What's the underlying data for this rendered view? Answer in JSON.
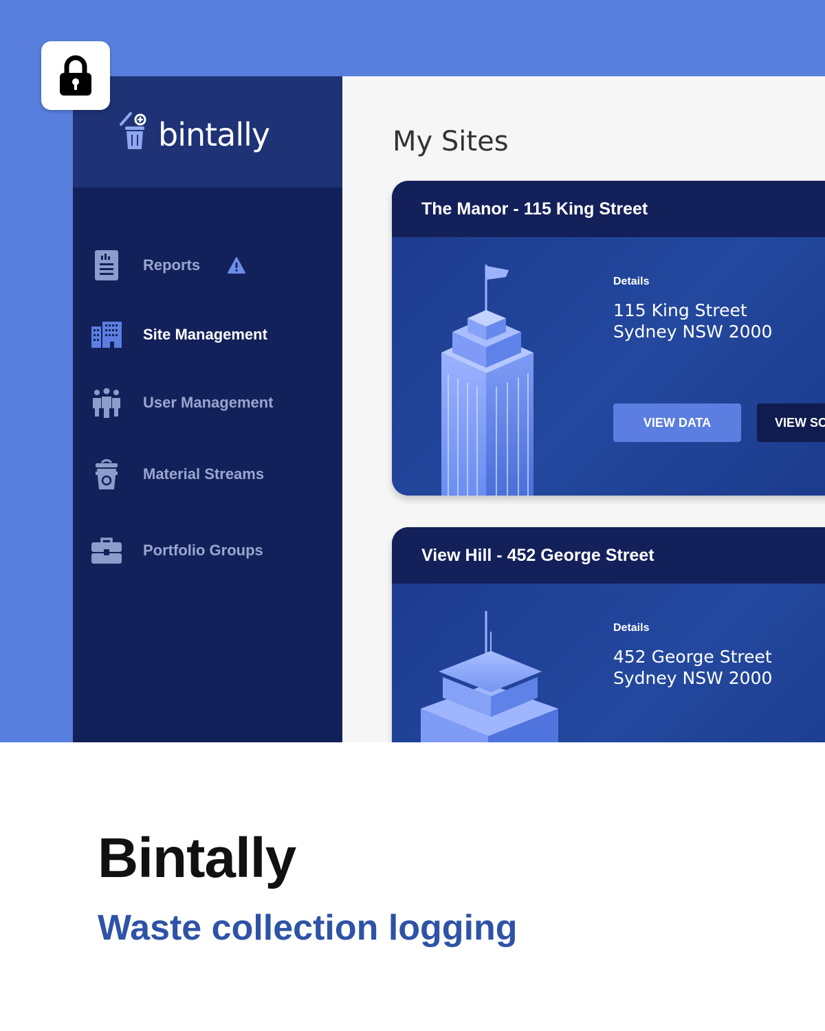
{
  "app": {
    "brand_name": "bintally"
  },
  "sidebar": {
    "items": [
      {
        "label": "Reports",
        "icon": "report-icon",
        "has_warning": true
      },
      {
        "label": "Site Management",
        "icon": "building-icon",
        "active": true
      },
      {
        "label": "User Management",
        "icon": "users-icon"
      },
      {
        "label": "Material Streams",
        "icon": "recycle-bin-icon"
      },
      {
        "label": "Portfolio Groups",
        "icon": "briefcase-icon"
      }
    ]
  },
  "main": {
    "title": "My Sites",
    "sites": [
      {
        "title": "The Manor - 115 King Street",
        "details_label": "Details",
        "address_line1": "115 King Street",
        "address_line2": "Sydney NSW 2000",
        "view_data_label": "VIEW DATA",
        "view_second_label": "VIEW SC"
      },
      {
        "title": "View Hill - 452 George Street",
        "details_label": "Details",
        "address_line1": "452 George Street",
        "address_line2": "Sydney NSW 2000"
      }
    ]
  },
  "caption": {
    "title": "Bintally",
    "subtitle": "Waste collection logging"
  },
  "colors": {
    "hero_bg": "#587fde",
    "sidebar_bg": "#13215a",
    "brand_bg": "#1e3275",
    "card_header": "#14205a",
    "accent": "#5b7ee0",
    "subtitle": "#2e53a6"
  }
}
